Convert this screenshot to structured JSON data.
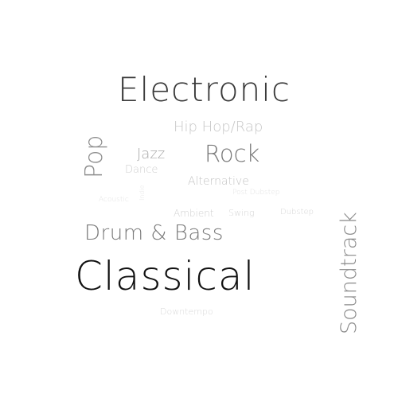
{
  "words": [
    {
      "id": "electronic",
      "text": "Electronic",
      "color": "#3a3a3a"
    },
    {
      "id": "hip-hop-rap",
      "text": "Hip Hop/Rap",
      "color": "#c7c7c7"
    },
    {
      "id": "pop",
      "text": "Pop",
      "color": "#8e8e8e"
    },
    {
      "id": "jazz",
      "text": "Jazz",
      "color": "#a8a8a8"
    },
    {
      "id": "rock",
      "text": "Rock",
      "color": "#7a7a7a"
    },
    {
      "id": "dance",
      "text": "Dance",
      "color": "#cfcfcf"
    },
    {
      "id": "alternative",
      "text": "Alternative",
      "color": "#c4c4c4"
    },
    {
      "id": "post-dubstep",
      "text": "Post Dubstep",
      "color": "#e2e2e2"
    },
    {
      "id": "acoustic",
      "text": "Acoustic",
      "color": "#e3e3e3"
    },
    {
      "id": "ambient",
      "text": "Ambient",
      "color": "#d0d0d0"
    },
    {
      "id": "swing",
      "text": "Swing",
      "color": "#d6d6d6"
    },
    {
      "id": "dubstep",
      "text": "Dubstep",
      "color": "#d6d6d6"
    },
    {
      "id": "indie",
      "text": "Indie",
      "color": "#e6e6e6"
    },
    {
      "id": "drum-bass",
      "text": "Drum & Bass",
      "color": "#7a7a7a"
    },
    {
      "id": "classical",
      "text": "Classical",
      "color": "#111111"
    },
    {
      "id": "soundtrack",
      "text": "Soundtrack",
      "color": "#8a8a8a"
    },
    {
      "id": "downtempo",
      "text": "Downtempo",
      "color": "#d9d9d9"
    }
  ]
}
